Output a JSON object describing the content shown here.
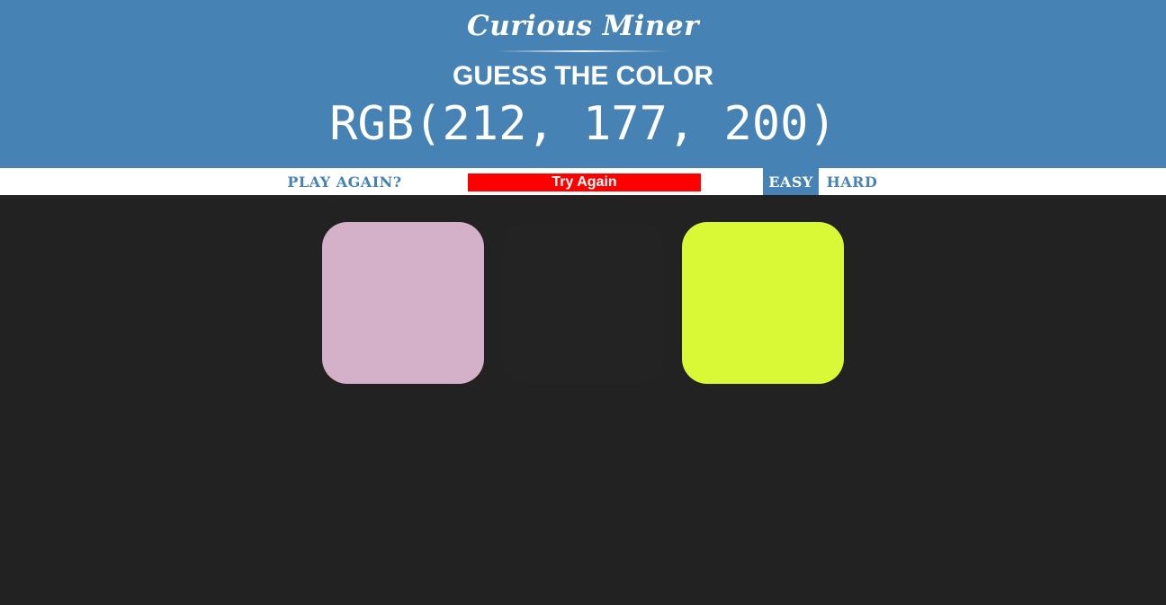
{
  "header": {
    "brand": "Curious Miner",
    "title": "GUESS THE COLOR",
    "rgb_target": "RGB(212, 177, 200)"
  },
  "controls": {
    "play_again_label": "PLAY AGAIN?",
    "message": "Try Again",
    "modes": [
      {
        "label": "EASY",
        "selected": true
      },
      {
        "label": "HARD",
        "selected": false
      }
    ]
  },
  "squares": [
    {
      "color": "#d4b1c8",
      "eliminated": false
    },
    {
      "color": "#232323",
      "eliminated": true
    },
    {
      "color": "#d9f937",
      "eliminated": false
    }
  ],
  "colors": {
    "header_bg": "#4682b4",
    "board_bg": "#222222",
    "message_bg": "#ff0000",
    "accent": "#4682b4"
  }
}
